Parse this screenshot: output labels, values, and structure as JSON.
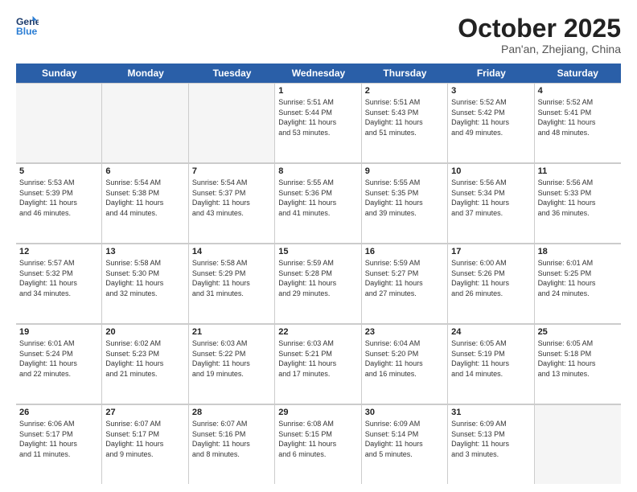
{
  "header": {
    "logo_line1": "General",
    "logo_line2": "Blue",
    "month_title": "October 2025",
    "location": "Pan'an, Zhejiang, China"
  },
  "weekdays": [
    "Sunday",
    "Monday",
    "Tuesday",
    "Wednesday",
    "Thursday",
    "Friday",
    "Saturday"
  ],
  "weeks": [
    [
      {
        "day": "",
        "info": "",
        "empty": true
      },
      {
        "day": "",
        "info": "",
        "empty": true
      },
      {
        "day": "",
        "info": "",
        "empty": true
      },
      {
        "day": "1",
        "info": "Sunrise: 5:51 AM\nSunset: 5:44 PM\nDaylight: 11 hours\nand 53 minutes."
      },
      {
        "day": "2",
        "info": "Sunrise: 5:51 AM\nSunset: 5:43 PM\nDaylight: 11 hours\nand 51 minutes."
      },
      {
        "day": "3",
        "info": "Sunrise: 5:52 AM\nSunset: 5:42 PM\nDaylight: 11 hours\nand 49 minutes."
      },
      {
        "day": "4",
        "info": "Sunrise: 5:52 AM\nSunset: 5:41 PM\nDaylight: 11 hours\nand 48 minutes."
      }
    ],
    [
      {
        "day": "5",
        "info": "Sunrise: 5:53 AM\nSunset: 5:39 PM\nDaylight: 11 hours\nand 46 minutes."
      },
      {
        "day": "6",
        "info": "Sunrise: 5:54 AM\nSunset: 5:38 PM\nDaylight: 11 hours\nand 44 minutes."
      },
      {
        "day": "7",
        "info": "Sunrise: 5:54 AM\nSunset: 5:37 PM\nDaylight: 11 hours\nand 43 minutes."
      },
      {
        "day": "8",
        "info": "Sunrise: 5:55 AM\nSunset: 5:36 PM\nDaylight: 11 hours\nand 41 minutes."
      },
      {
        "day": "9",
        "info": "Sunrise: 5:55 AM\nSunset: 5:35 PM\nDaylight: 11 hours\nand 39 minutes."
      },
      {
        "day": "10",
        "info": "Sunrise: 5:56 AM\nSunset: 5:34 PM\nDaylight: 11 hours\nand 37 minutes."
      },
      {
        "day": "11",
        "info": "Sunrise: 5:56 AM\nSunset: 5:33 PM\nDaylight: 11 hours\nand 36 minutes."
      }
    ],
    [
      {
        "day": "12",
        "info": "Sunrise: 5:57 AM\nSunset: 5:32 PM\nDaylight: 11 hours\nand 34 minutes."
      },
      {
        "day": "13",
        "info": "Sunrise: 5:58 AM\nSunset: 5:30 PM\nDaylight: 11 hours\nand 32 minutes."
      },
      {
        "day": "14",
        "info": "Sunrise: 5:58 AM\nSunset: 5:29 PM\nDaylight: 11 hours\nand 31 minutes."
      },
      {
        "day": "15",
        "info": "Sunrise: 5:59 AM\nSunset: 5:28 PM\nDaylight: 11 hours\nand 29 minutes."
      },
      {
        "day": "16",
        "info": "Sunrise: 5:59 AM\nSunset: 5:27 PM\nDaylight: 11 hours\nand 27 minutes."
      },
      {
        "day": "17",
        "info": "Sunrise: 6:00 AM\nSunset: 5:26 PM\nDaylight: 11 hours\nand 26 minutes."
      },
      {
        "day": "18",
        "info": "Sunrise: 6:01 AM\nSunset: 5:25 PM\nDaylight: 11 hours\nand 24 minutes."
      }
    ],
    [
      {
        "day": "19",
        "info": "Sunrise: 6:01 AM\nSunset: 5:24 PM\nDaylight: 11 hours\nand 22 minutes."
      },
      {
        "day": "20",
        "info": "Sunrise: 6:02 AM\nSunset: 5:23 PM\nDaylight: 11 hours\nand 21 minutes."
      },
      {
        "day": "21",
        "info": "Sunrise: 6:03 AM\nSunset: 5:22 PM\nDaylight: 11 hours\nand 19 minutes."
      },
      {
        "day": "22",
        "info": "Sunrise: 6:03 AM\nSunset: 5:21 PM\nDaylight: 11 hours\nand 17 minutes."
      },
      {
        "day": "23",
        "info": "Sunrise: 6:04 AM\nSunset: 5:20 PM\nDaylight: 11 hours\nand 16 minutes."
      },
      {
        "day": "24",
        "info": "Sunrise: 6:05 AM\nSunset: 5:19 PM\nDaylight: 11 hours\nand 14 minutes."
      },
      {
        "day": "25",
        "info": "Sunrise: 6:05 AM\nSunset: 5:18 PM\nDaylight: 11 hours\nand 13 minutes."
      }
    ],
    [
      {
        "day": "26",
        "info": "Sunrise: 6:06 AM\nSunset: 5:17 PM\nDaylight: 11 hours\nand 11 minutes."
      },
      {
        "day": "27",
        "info": "Sunrise: 6:07 AM\nSunset: 5:17 PM\nDaylight: 11 hours\nand 9 minutes."
      },
      {
        "day": "28",
        "info": "Sunrise: 6:07 AM\nSunset: 5:16 PM\nDaylight: 11 hours\nand 8 minutes."
      },
      {
        "day": "29",
        "info": "Sunrise: 6:08 AM\nSunset: 5:15 PM\nDaylight: 11 hours\nand 6 minutes."
      },
      {
        "day": "30",
        "info": "Sunrise: 6:09 AM\nSunset: 5:14 PM\nDaylight: 11 hours\nand 5 minutes."
      },
      {
        "day": "31",
        "info": "Sunrise: 6:09 AM\nSunset: 5:13 PM\nDaylight: 11 hours\nand 3 minutes."
      },
      {
        "day": "",
        "info": "",
        "empty": true
      }
    ]
  ]
}
